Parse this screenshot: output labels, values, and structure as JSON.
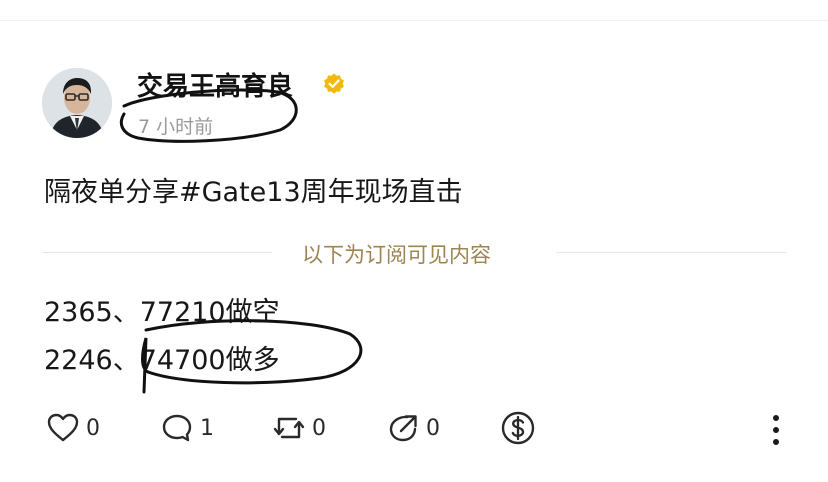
{
  "post": {
    "author": "交易王高育良",
    "time": "7 小时前",
    "text": "隔夜单分享#Gate13周年现场直击",
    "divider_label": "以下为订阅可见内容",
    "content_lines": [
      "2365、77210做空",
      "2246、74700做多"
    ]
  },
  "actions": {
    "like_count": "0",
    "comment_count": "1",
    "repost_count": "0",
    "share_count": "0"
  },
  "icons": {
    "verified": "verified-badge-icon",
    "like": "heart-icon",
    "comment": "comment-bubble-icon",
    "repost": "repost-icon",
    "share": "share-arrow-icon",
    "tip": "dollar-coin-icon",
    "more": "more-vertical-icon"
  },
  "colors": {
    "verified": "#f0b90b",
    "divider_text": "#9c8552",
    "muted_text": "#9a9a9a",
    "ink": "#141414"
  }
}
